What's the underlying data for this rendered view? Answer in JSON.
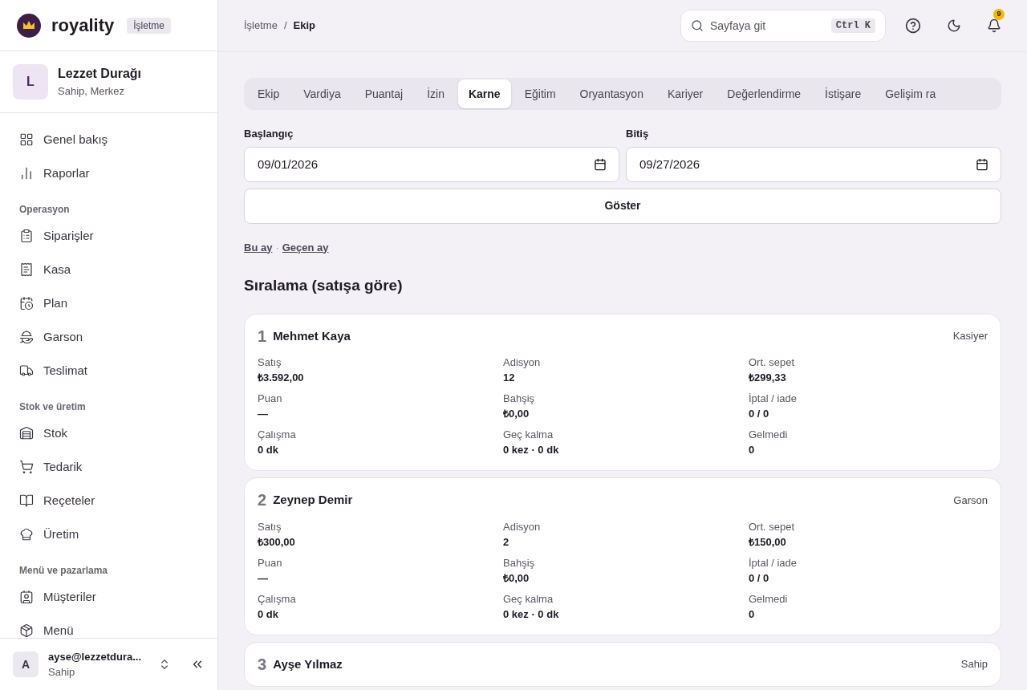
{
  "brand": {
    "name": "royality",
    "badge": "İşletme"
  },
  "business": {
    "initial": "L",
    "name": "Lezzet Durağı",
    "role": "Sahip, Merkez"
  },
  "sidebar": {
    "sections": [
      {
        "items": [
          {
            "label": "Genel bakış"
          },
          {
            "label": "Raporlar"
          }
        ]
      },
      {
        "title": "Operasyon",
        "items": [
          {
            "label": "Siparişler"
          },
          {
            "label": "Kasa"
          },
          {
            "label": "Plan"
          },
          {
            "label": "Garson"
          },
          {
            "label": "Teslimat"
          }
        ]
      },
      {
        "title": "Stok ve üretim",
        "items": [
          {
            "label": "Stok"
          },
          {
            "label": "Tedarik"
          },
          {
            "label": "Reçeteler"
          },
          {
            "label": "Üretim"
          }
        ]
      },
      {
        "title": "Menü ve pazarlama",
        "items": [
          {
            "label": "Müşteriler"
          },
          {
            "label": "Menü"
          }
        ]
      }
    ]
  },
  "user": {
    "initial": "A",
    "email": "ayse@lezzetdura...",
    "role": "Sahip"
  },
  "breadcrumb": [
    "İşletme",
    "/",
    "Ekip"
  ],
  "search": {
    "placeholder": "Sayfaya git",
    "shortcut": "Ctrl K"
  },
  "notifications": {
    "count": "9"
  },
  "tabs": [
    {
      "label": "Ekip",
      "selected": false
    },
    {
      "label": "Vardiya",
      "selected": false
    },
    {
      "label": "Puantaj",
      "selected": false
    },
    {
      "label": "İzin",
      "selected": false
    },
    {
      "label": "Karne",
      "selected": true
    },
    {
      "label": "Eğitim",
      "selected": false
    },
    {
      "label": "Oryantasyon",
      "selected": false
    },
    {
      "label": "Kariyer",
      "selected": false
    },
    {
      "label": "Değerlendirme",
      "selected": false
    },
    {
      "label": "İstişare",
      "selected": false
    },
    {
      "label": "Gelişim ra",
      "selected": false
    }
  ],
  "filters": [
    {
      "label": "Başlangıç",
      "value": "09/01/2026"
    },
    {
      "label": "Bitiş",
      "value": "09/27/2026"
    }
  ],
  "show_button": "Göster",
  "quick_links": [
    "Bu ay",
    "·",
    "Geçen ay"
  ],
  "ranking_title": "Sıralama (satışa göre)",
  "cards": [
    {
      "rank": "1",
      "name": "Mehmet Kaya",
      "role": "Kasiyer",
      "stats": [
        {
          "label": "Satış",
          "value": "₺3.592,00"
        },
        {
          "label": "Adisyon",
          "value": "12"
        },
        {
          "label": "Ort. sepet",
          "value": "₺299,33"
        },
        {
          "label": "Puan",
          "value": "—"
        },
        {
          "label": "Bahşiş",
          "value": "₺0,00"
        },
        {
          "label": "İptal / iade",
          "value": "0 / 0"
        },
        {
          "label": "Çalışma",
          "value": "0 dk"
        },
        {
          "label": "Geç kalma",
          "value": "0 kez · 0 dk"
        },
        {
          "label": "Gelmedi",
          "value": "0"
        }
      ]
    },
    {
      "rank": "2",
      "name": "Zeynep Demir",
      "role": "Garson",
      "stats": [
        {
          "label": "Satış",
          "value": "₺300,00"
        },
        {
          "label": "Adisyon",
          "value": "2"
        },
        {
          "label": "Ort. sepet",
          "value": "₺150,00"
        },
        {
          "label": "Puan",
          "value": "—"
        },
        {
          "label": "Bahşiş",
          "value": "₺0,00"
        },
        {
          "label": "İptal / iade",
          "value": "0 / 0"
        },
        {
          "label": "Çalışma",
          "value": "0 dk"
        },
        {
          "label": "Geç kalma",
          "value": "0 kez · 0 dk"
        },
        {
          "label": "Gelmedi",
          "value": "0"
        }
      ]
    },
    {
      "rank": "3",
      "name": "Ayşe Yılmaz",
      "role": "Sahip"
    }
  ]
}
